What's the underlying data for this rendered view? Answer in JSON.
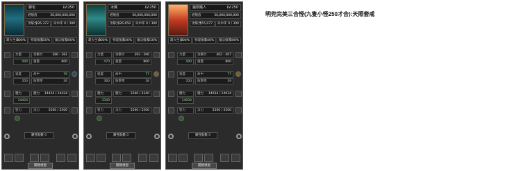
{
  "caption": "明兜完美三合怪(九隻小怪250才合):天照套戒",
  "panels": [
    {
      "name": "腳毛",
      "level": "LV:250",
      "rows": {
        "exp_label": "經驗值",
        "exp_value": "30,000,000,000",
        "a_label": "攻擊力",
        "a_value": "226,372",
        "b_label": "命中率",
        "b_value": "0 / 300",
        "c_label": "最大生命",
        "c_value": "300%",
        "d_label": "物理傷害",
        "d_value": "150%",
        "e_label": "魔法傷害",
        "e_value": "200%"
      },
      "stats": [
        {
          "label": "力量",
          "value": "440",
          "sub_label": "攻擊力",
          "sub_value": "366 - 381"
        },
        {
          "label": "敏捷",
          "value": "",
          "sub_label": "重量",
          "sub_value": "800"
        },
        {
          "label": "速度",
          "value": "350",
          "sub_label": "命中",
          "sub_value": "76"
        },
        {
          "label": "防禦",
          "value": "",
          "sub_label": "防禦率",
          "sub_value": "36"
        },
        {
          "label": "體力",
          "value": "14424",
          "sub_label": "體力",
          "sub_value": "14424 / 14424"
        },
        {
          "label": "智力",
          "value": "",
          "sub_label": "法力",
          "sub_value": "5500 / 5500"
        }
      ],
      "bottom_label": "屬性點數",
      "bottom_value": "0",
      "button": "關閉視窗"
    },
    {
      "name": "冰寶",
      "level": "LV:250",
      "rows": {
        "exp_label": "經驗值",
        "exp_value": "30,000,000,000",
        "a_label": "攻擊力",
        "a_value": "326,658",
        "b_label": "命中率",
        "b_value": "0 / 300",
        "c_label": "最大生命",
        "c_value": "300%",
        "d_label": "物理傷害",
        "d_value": "140%",
        "e_label": "魔法傷害",
        "e_value": "210%"
      },
      "stats": [
        {
          "label": "力量",
          "value": "470",
          "sub_label": "攻擊力",
          "sub_value": "393 - 396"
        },
        {
          "label": "敏捷",
          "value": "",
          "sub_label": "重量",
          "sub_value": "800"
        },
        {
          "label": "速度",
          "value": "360",
          "sub_label": "命中",
          "sub_value": "77"
        },
        {
          "label": "防禦",
          "value": "",
          "sub_label": "防禦率",
          "sub_value": "38"
        },
        {
          "label": "體力",
          "value": "3340",
          "sub_label": "體力",
          "sub_value": "3340 / 3340"
        },
        {
          "label": "智力",
          "value": "",
          "sub_label": "法力",
          "sub_value": "5500 / 5500"
        }
      ],
      "bottom_label": "屬性點數",
      "bottom_value": "0",
      "button": "關閉視窗"
    },
    {
      "name": "魔頭鐵人",
      "level": "LV:250",
      "rows": {
        "exp_label": "經驗值",
        "exp_value": "30,000,000,000",
        "a_label": "攻擊力",
        "a_value": "555,077",
        "b_label": "命中率",
        "b_value": "0 / 300",
        "c_label": "最大生命",
        "c_value": "300%",
        "d_label": "物理傷害",
        "d_value": "140%",
        "e_label": "魔法傷害",
        "e_value": "200%"
      },
      "stats": [
        {
          "label": "力量",
          "value": "490",
          "sub_label": "攻擊力",
          "sub_value": "402 - 407"
        },
        {
          "label": "敏捷",
          "value": "",
          "sub_label": "重量",
          "sub_value": "800"
        },
        {
          "label": "速度",
          "value": "350",
          "sub_label": "命中",
          "sub_value": "77"
        },
        {
          "label": "防禦",
          "value": "",
          "sub_label": "防禦率",
          "sub_value": "39"
        },
        {
          "label": "體力",
          "value": "14934",
          "sub_label": "體力",
          "sub_value": "14934 / 14934"
        },
        {
          "label": "智力",
          "value": "",
          "sub_label": "法力",
          "sub_value": "5500 / 5500"
        }
      ],
      "bottom_label": "屬性點數",
      "bottom_value": "0",
      "button": "關閉視窗"
    }
  ],
  "icons": {
    "portrait_1": "monster-portrait-blue",
    "portrait_2": "monster-portrait-teal",
    "portrait_3": "monster-portrait-red"
  },
  "colors": {
    "panel_bg": "#2b2b2b",
    "value_green": "#9be29b"
  }
}
